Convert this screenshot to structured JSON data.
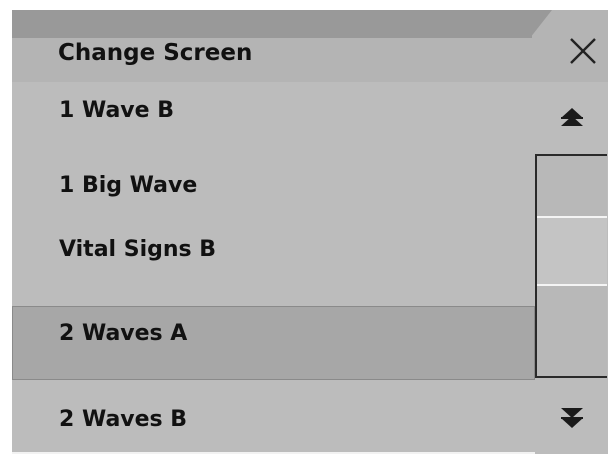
{
  "dialog": {
    "title": "Change Screen",
    "close_icon": "close-icon"
  },
  "list": {
    "items": [
      {
        "label": "1 Wave B",
        "selected": false
      },
      {
        "label": "1 Big Wave",
        "selected": false
      },
      {
        "label": "Vital Signs B",
        "selected": false
      },
      {
        "label": "2 Waves A",
        "selected": true
      },
      {
        "label": "2 Waves B",
        "selected": false
      }
    ]
  },
  "scrollbar": {
    "up_icon": "double-chevron-up-icon",
    "down_icon": "double-chevron-down-icon"
  },
  "colors": {
    "background": "#bcbcbc",
    "title_strip": "#999999",
    "selected_row": "#a7a7a7"
  }
}
